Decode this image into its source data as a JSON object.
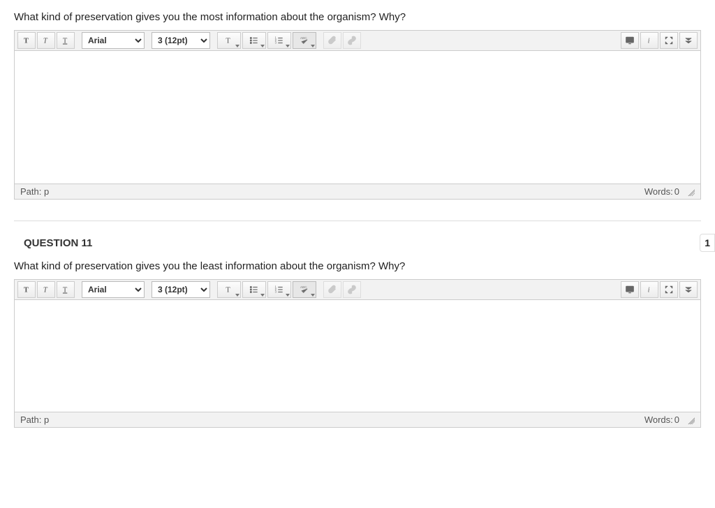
{
  "editor_defaults": {
    "font_family": "Arial",
    "font_size": "3 (12pt)",
    "path_label": "Path:",
    "path_value": "p",
    "words_label": "Words:",
    "words_value": "0"
  },
  "question10": {
    "prompt": "What kind of preservation gives you the most information about the organism? Why?"
  },
  "question11": {
    "header": "QUESTION 11",
    "points": "1",
    "prompt": "What kind of preservation gives you the least information about the organism? Why?"
  }
}
